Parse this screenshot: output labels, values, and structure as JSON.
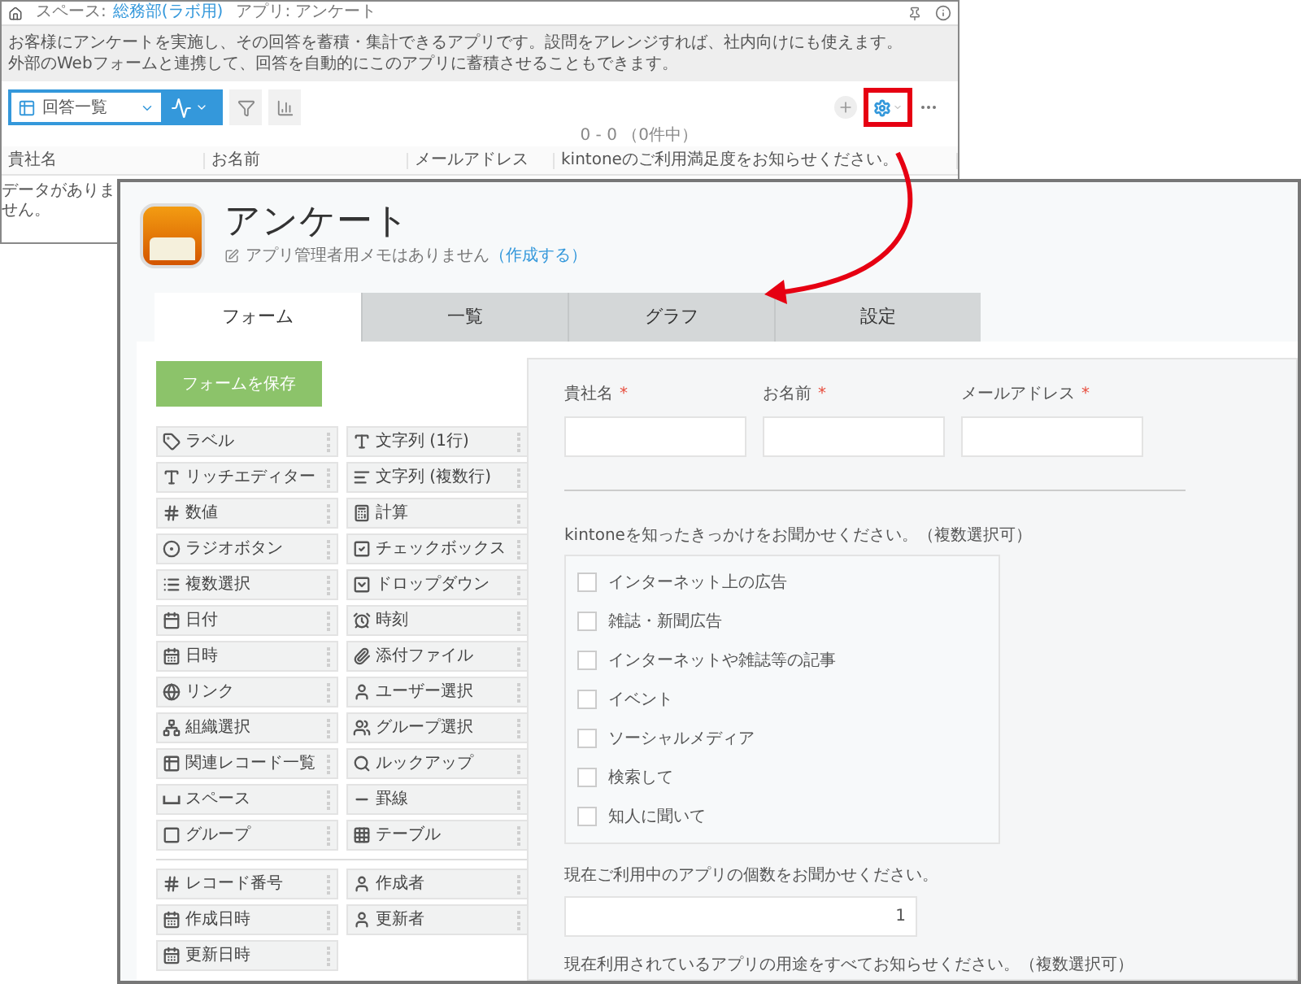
{
  "back_window": {
    "breadcrumbs": [
      {
        "label": "スペース:",
        "link": "総務部(ラボ用)"
      },
      {
        "label": "アプリ: アンケート"
      }
    ],
    "description": [
      "お客様にアンケートを実施し、その回答を蓄積・集計できるアプリです。設問をアレンジすれば、社内向けにも使えます。",
      "外部のWebフォームと連携して、回答を自動的にこのアプリに蓄積させることもできます。"
    ],
    "view_select": "回答一覧",
    "count": "0 - 0 （0件中）",
    "table": {
      "columns": [
        "貴社名",
        "お名前",
        "メールアドレス",
        "kintoneのご利用満足度をお知らせください。"
      ],
      "empty": "データがありません。"
    }
  },
  "app": {
    "title": "アンケート",
    "memo": "アプリ管理者用メモはありません",
    "memo_link": "（作成する）"
  },
  "tabs": [
    {
      "label": "フォーム",
      "selected": true
    },
    {
      "label": "一覧",
      "selected": false
    },
    {
      "label": "グラフ",
      "selected": false
    },
    {
      "label": "設定",
      "selected": false
    }
  ],
  "palette": {
    "save_button": "フォームを保存",
    "fields": [
      {
        "label": "ラベル",
        "kind": "label"
      },
      {
        "label": "文字列 (1行)",
        "kind": "text"
      },
      {
        "label": "リッチエディター",
        "kind": "rich"
      },
      {
        "label": "文字列 (複数行)",
        "kind": "multiline"
      },
      {
        "label": "数値",
        "kind": "number"
      },
      {
        "label": "計算",
        "kind": "calc"
      },
      {
        "label": "ラジオボタン",
        "kind": "radio"
      },
      {
        "label": "チェックボックス",
        "kind": "checkbox"
      },
      {
        "label": "複数選択",
        "kind": "multiselect"
      },
      {
        "label": "ドロップダウン",
        "kind": "dropdown"
      },
      {
        "label": "日付",
        "kind": "date"
      },
      {
        "label": "時刻",
        "kind": "time"
      },
      {
        "label": "日時",
        "kind": "datetime"
      },
      {
        "label": "添付ファイル",
        "kind": "file"
      },
      {
        "label": "リンク",
        "kind": "link"
      },
      {
        "label": "ユーザー選択",
        "kind": "user"
      },
      {
        "label": "組織選択",
        "kind": "org"
      },
      {
        "label": "グループ選択",
        "kind": "group_select"
      },
      {
        "label": "関連レコード一覧",
        "kind": "related"
      },
      {
        "label": "ルックアップ",
        "kind": "lookup"
      },
      {
        "label": "スペース",
        "kind": "space"
      },
      {
        "label": "罫線",
        "kind": "line"
      },
      {
        "label": "グループ",
        "kind": "group"
      },
      {
        "label": "テーブル",
        "kind": "table"
      }
    ],
    "system_fields": [
      {
        "label": "レコード番号",
        "kind": "number"
      },
      {
        "label": "作成者",
        "kind": "user"
      },
      {
        "label": "作成日時",
        "kind": "datetime"
      },
      {
        "label": "更新者",
        "kind": "user"
      },
      {
        "label": "更新日時",
        "kind": "datetime"
      }
    ]
  },
  "form": {
    "text_fields": [
      {
        "label": "貴社名",
        "required_mark": "*"
      },
      {
        "label": "お名前",
        "required_mark": "*"
      },
      {
        "label": "メールアドレス",
        "required_mark": "*"
      }
    ],
    "checkbox_group": {
      "label": "kintoneを知ったきっかけをお聞かせください。（複数選択可）",
      "options": [
        {
          "label": "インターネット上の広告",
          "checked": false
        },
        {
          "label": "雑誌・新聞広告",
          "checked": false
        },
        {
          "label": "インターネットや雑誌等の記事",
          "checked": false
        },
        {
          "label": "イベント",
          "checked": false
        },
        {
          "label": "ソーシャルメディア",
          "checked": false
        },
        {
          "label": "検索して",
          "checked": false
        },
        {
          "label": "知人に聞いて",
          "checked": false
        }
      ]
    },
    "number_field": {
      "label": "現在ご利用中のアプリの個数をお聞かせください。",
      "value": "1"
    },
    "next_label": "現在利用されているアプリの用途をすべてお知らせください。（複数選択可）"
  }
}
